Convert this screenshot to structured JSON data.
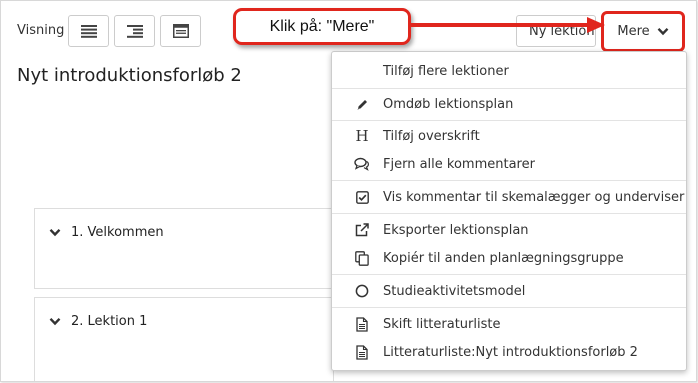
{
  "toolbar": {
    "visning_label": "Visning",
    "ny_lektion_label": "Ny lektion",
    "mere_label": "Mere"
  },
  "page": {
    "title": "Nyt introduktionsforløb 2"
  },
  "callout": {
    "text": "Klik på: \"Mere\""
  },
  "lessons": [
    {
      "label": "1. Velkommen"
    },
    {
      "label": "2. Lektion 1"
    }
  ],
  "menu": {
    "items": [
      {
        "label": "Tilføj flere lektioner",
        "icon": "none"
      },
      {
        "label": "Omdøb lektionsplan",
        "icon": "pencil-icon"
      },
      {
        "label": "Tilføj overskrift",
        "icon": "heading-icon"
      },
      {
        "label": "Fjern alle kommentarer",
        "icon": "comments-icon"
      },
      {
        "label": "Vis kommentar til skemalægger og underviser",
        "icon": "checkbox-icon"
      },
      {
        "label": "Eksporter lektionsplan",
        "icon": "external-link-icon"
      },
      {
        "label": "Kopiér til anden planlægningsgruppe",
        "icon": "copy-icon"
      },
      {
        "label": "Studieaktivitetsmodel",
        "icon": "circle-icon"
      },
      {
        "label": "Skift litteraturliste",
        "icon": "document-icon"
      },
      {
        "label": "Litteraturliste:Nyt introduktionsforløb 2",
        "icon": "document-icon"
      }
    ]
  },
  "colors": {
    "highlight": "#e0261d"
  }
}
